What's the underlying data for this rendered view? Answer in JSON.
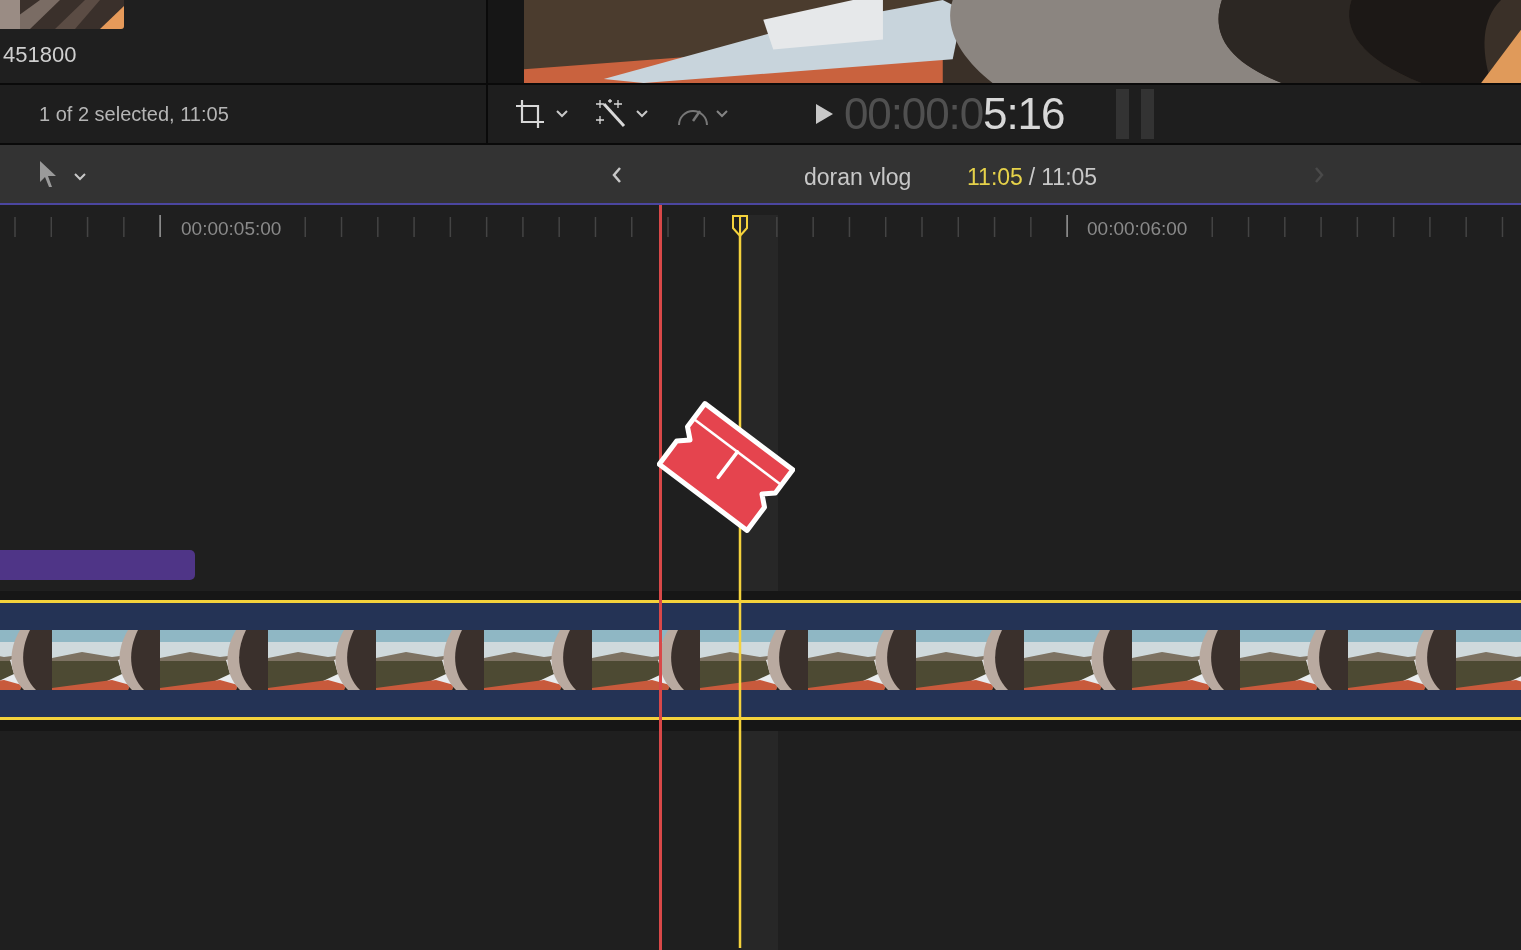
{
  "browser": {
    "clip_label": "451800",
    "status": "1 of 2 selected, 11:05"
  },
  "viewer": {
    "kind": "picture",
    "timecode": {
      "inactive": "00:00:0",
      "active": "5:16"
    }
  },
  "timeline_toolbar": {
    "project_name": "doran vlog",
    "position": "11:05",
    "separator": "/",
    "duration": "11:05",
    "back_disabled": false,
    "forward_disabled": true
  },
  "ruler": {
    "labels": [
      "00:00:05:00",
      "00:00:06:00"
    ]
  },
  "timeline": {
    "clip": {
      "selected": true
    },
    "skimmer": true
  }
}
